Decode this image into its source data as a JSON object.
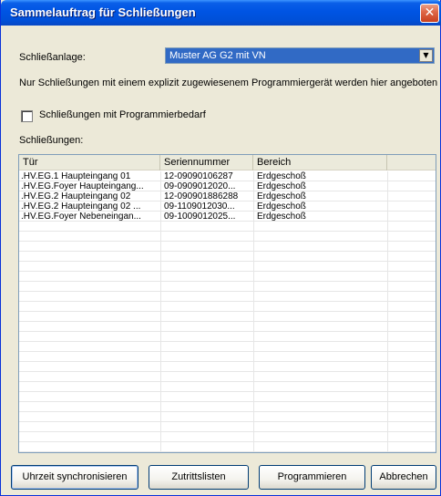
{
  "window": {
    "title": "Sammelauftrag für Schließungen",
    "close_glyph": "✕"
  },
  "anlage": {
    "label": "Schließanlage:",
    "value": "Muster AG G2 mit VN"
  },
  "info_text": "Nur Schließungen mit einem explizit zugewiesenem Programmiergerät werden hier angeboten",
  "checkbox": {
    "label": "Schließungen mit Programmierbedarf",
    "checked": false
  },
  "list_label": "Schließungen:",
  "table": {
    "columns": [
      "Tür",
      "Seriennummer",
      "Bereich",
      ""
    ],
    "rows": [
      [
        ".HV.EG.1 Haupteingang 01",
        "12-09090106287",
        "Erdgeschoß"
      ],
      [
        ".HV.EG.Foyer Haupteingang...",
        "09-0909012020...",
        "Erdgeschoß"
      ],
      [
        ".HV.EG.2 Haupteingang 02",
        "12-090901886288",
        "Erdgeschoß"
      ],
      [
        ".HV.EG.2 Haupteingang 02 ...",
        "09-1109012030...",
        "Erdgeschoß"
      ],
      [
        ".HV.EG.Foyer Nebeneingan...",
        "09-1009012025...",
        "Erdgeschoß"
      ]
    ]
  },
  "buttons": {
    "sync": "Uhrzeit synchronisieren",
    "zutritt": "Zutrittslisten",
    "programmieren": "Programmieren",
    "abbrechen": "Abbrechen"
  }
}
